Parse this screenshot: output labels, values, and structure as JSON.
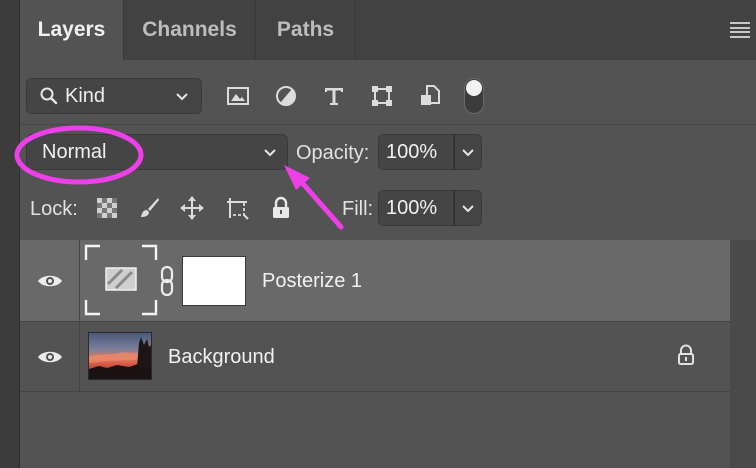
{
  "tabs": [
    {
      "label": "Layers",
      "active": true
    },
    {
      "label": "Channels",
      "active": false
    },
    {
      "label": "Paths",
      "active": false
    }
  ],
  "filter": {
    "kind_label": "Kind",
    "icons": [
      "image-filter-icon",
      "adjustment-filter-icon",
      "type-filter-icon",
      "shape-filter-icon",
      "smart-object-filter-icon"
    ],
    "toggle_on": true
  },
  "blend": {
    "mode": "Normal",
    "opacity_label": "Opacity:",
    "opacity_value": "100%"
  },
  "lock": {
    "label": "Lock:",
    "fill_label": "Fill:",
    "fill_value": "100%"
  },
  "layers": [
    {
      "name": "Posterize 1",
      "visible": true,
      "selected": true,
      "type": "adjustment"
    },
    {
      "name": "Background",
      "visible": true,
      "selected": false,
      "locked": true,
      "type": "image"
    }
  ],
  "annotation": {
    "color": "#ee3fe8",
    "target": "blend-mode-select"
  },
  "colors": {
    "panel_bg": "#535353",
    "tabbar_bg": "#424242",
    "selected_row": "#696969",
    "annotation": "#ee3fe8"
  }
}
